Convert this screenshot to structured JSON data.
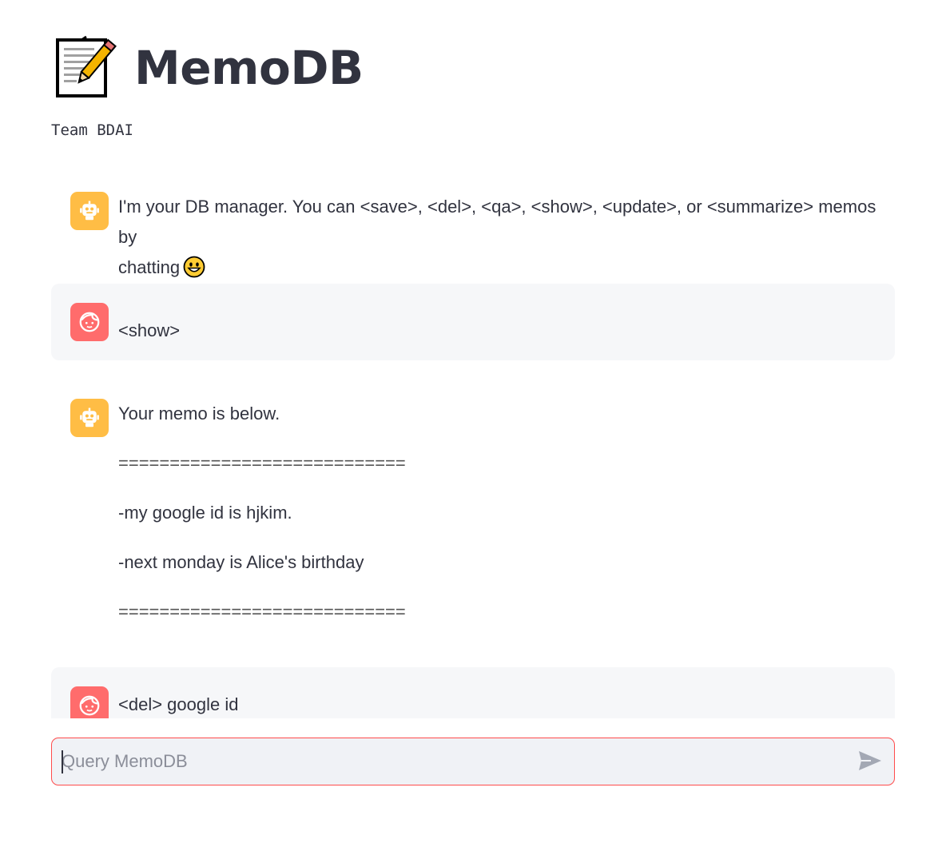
{
  "app": {
    "title": "MemoDB",
    "title_icon": "memo-icon",
    "subtitle": "Team BDAI"
  },
  "messages": [
    {
      "role": "assistant",
      "avatar_icon": "robot-icon",
      "lines": [
        "I'm your DB manager. You can <save>, <del>, <qa>, <show>, <update>, or <summarize> memos by",
        "chatting"
      ],
      "emoji": "grinning-face-icon"
    },
    {
      "role": "user",
      "avatar_icon": "user-face-icon",
      "lines": [
        "<show>"
      ]
    },
    {
      "role": "assistant",
      "avatar_icon": "robot-icon",
      "lines": [
        "Your memo is below.",
        "============================",
        "-my google id is hjkim.",
        "-next monday is Alice's birthday",
        "============================"
      ]
    },
    {
      "role": "user",
      "avatar_icon": "user-face-icon",
      "lines": [
        "<del> google id"
      ]
    }
  ],
  "chat_input": {
    "placeholder": "Query MemoDB",
    "value": "",
    "send_icon": "send-icon"
  },
  "colors": {
    "assistant_avatar": "#ffbd45",
    "user_avatar": "#ff6c6c",
    "user_bubble": "#f6f7f9",
    "input_border_focus": "#ff4b4b",
    "input_bg": "#f0f2f6"
  }
}
